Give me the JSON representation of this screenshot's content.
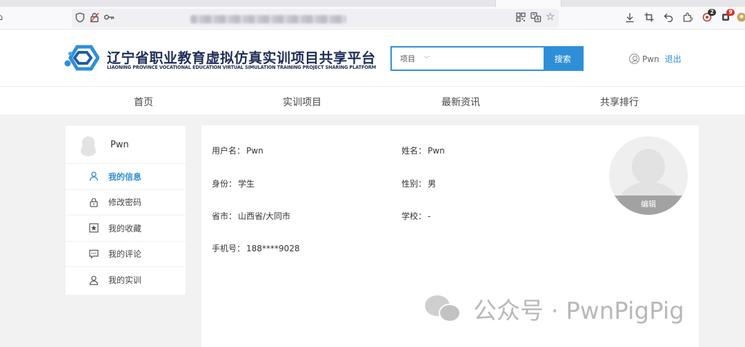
{
  "browser": {
    "url": "",
    "badges": {
      "first": "2",
      "second": "9"
    },
    "colors": {
      "badge_dark": "#333333",
      "badge_red": "#d93025"
    }
  },
  "site": {
    "title": "辽宁省职业教育虚拟仿真实训项目共享平台",
    "subtitle": "LIAONING PROVINCE VOCATIONAL EDUCATION VIRTUAL SIMULATION TRAINING PROJECT SHARING PLATFORM",
    "brand_color": "#2e8fd8"
  },
  "search": {
    "type_label": "项目",
    "placeholder": "",
    "button_label": "搜索"
  },
  "user": {
    "name": "Pwn",
    "logout_label": "退出"
  },
  "nav": {
    "items": [
      "首页",
      "实训项目",
      "最新资讯",
      "共享排行"
    ]
  },
  "sidebar": {
    "username": "Pwn",
    "items": [
      {
        "label": "我的信息",
        "icon": "person-icon",
        "active": true
      },
      {
        "label": "修改密码",
        "icon": "lock-icon",
        "active": false
      },
      {
        "label": "我的收藏",
        "icon": "star-icon",
        "active": false
      },
      {
        "label": "我的评论",
        "icon": "comment-icon",
        "active": false
      },
      {
        "label": "我的实训",
        "icon": "person-icon",
        "active": false
      }
    ]
  },
  "profile": {
    "username_label": "用户名：",
    "username": "Pwn",
    "name_label": "姓名：",
    "name": "Pwn",
    "identity_label": "身份：",
    "identity": "学生",
    "gender_label": "性别：",
    "gender": "男",
    "province_label": "省市：",
    "province": "山西省/大同市",
    "school_label": "学校：",
    "school": "-",
    "phone_label": "手机号：",
    "phone": "188****9028",
    "edit_label": "编辑"
  },
  "watermark": {
    "text": "公众号 · PwnPigPig"
  }
}
